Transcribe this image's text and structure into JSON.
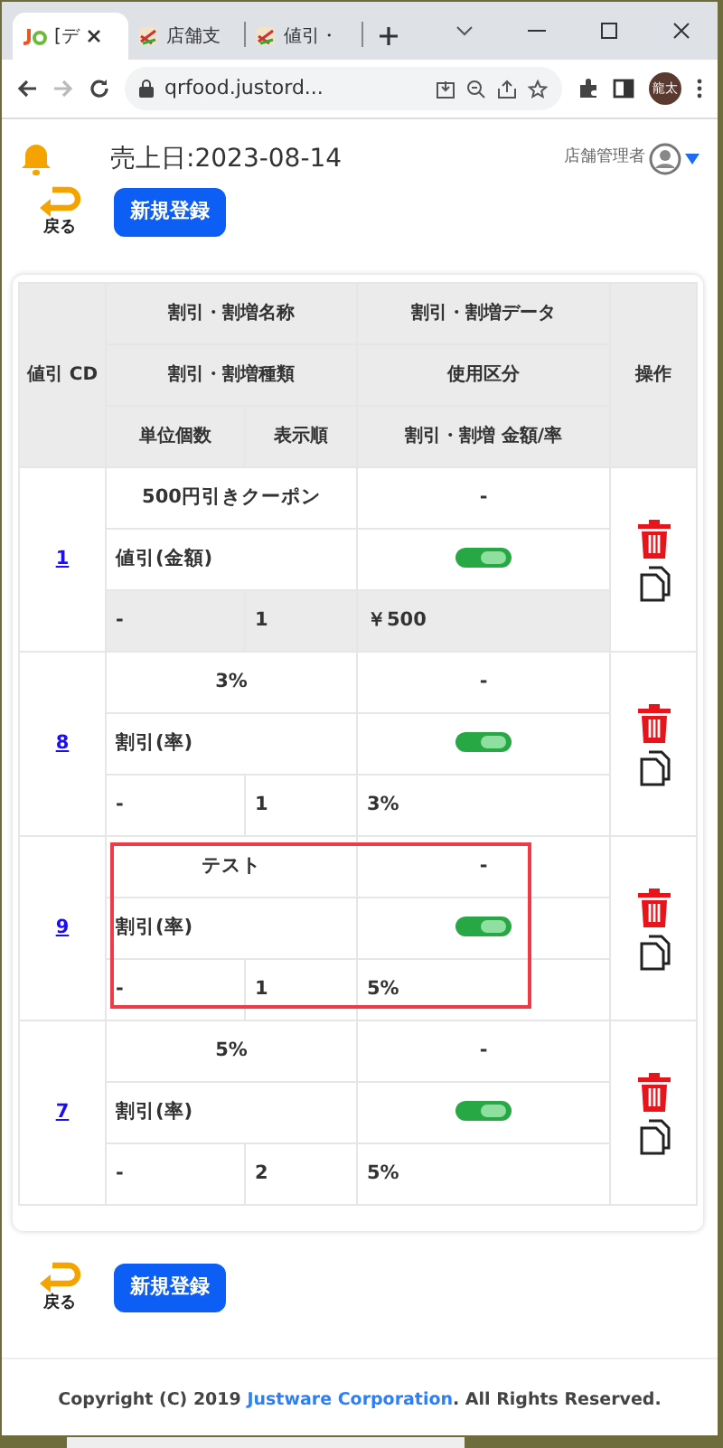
{
  "browser": {
    "tabs": [
      {
        "title": "[デ",
        "selected": true,
        "kind": "logo"
      },
      {
        "title": "店舗支",
        "selected": false,
        "kind": "app"
      },
      {
        "title": "値引・",
        "selected": false,
        "kind": "app"
      }
    ],
    "address": "qrfood.justord...",
    "profile": "龍太"
  },
  "header": {
    "sales_date": "売上日:2023-08-14",
    "user": "店舗管理者"
  },
  "top_actions": {
    "back": "戻る",
    "new": "新規登録"
  },
  "table": {
    "headers": {
      "code": "値引 CD",
      "name": "割引・割増名称",
      "data": "割引・割増データ",
      "type": "割引・割増種類",
      "usage": "使用区分",
      "unit": "単位個数",
      "order": "表示順",
      "amount": "割引・割増 金額/率",
      "ops": "操作"
    },
    "rows": [
      {
        "code": "1",
        "name": "500円引きクーポン",
        "data": "-",
        "type": "値引(金額)",
        "enabled": true,
        "unit": "-",
        "order": "1",
        "amount": "￥500",
        "hovered": true,
        "highlighted": false
      },
      {
        "code": "8",
        "name": "3%",
        "data": "-",
        "type": "割引(率)",
        "enabled": true,
        "unit": "-",
        "order": "1",
        "amount": "3%",
        "hovered": false,
        "highlighted": false
      },
      {
        "code": "9",
        "name": "テスト",
        "data": "-",
        "type": "割引(率)",
        "enabled": true,
        "unit": "-",
        "order": "1",
        "amount": "5%",
        "hovered": false,
        "highlighted": true
      },
      {
        "code": "7",
        "name": "5%",
        "data": "-",
        "type": "割引(率)",
        "enabled": true,
        "unit": "-",
        "order": "2",
        "amount": "5%",
        "hovered": false,
        "highlighted": false
      }
    ]
  },
  "bottom_actions": {
    "back": "戻る",
    "new": "新規登録"
  },
  "footer": {
    "prefix": "Copyright (C) 2019 ",
    "link": "Justware Corporation",
    "suffix": ". All Rights Reserved."
  }
}
